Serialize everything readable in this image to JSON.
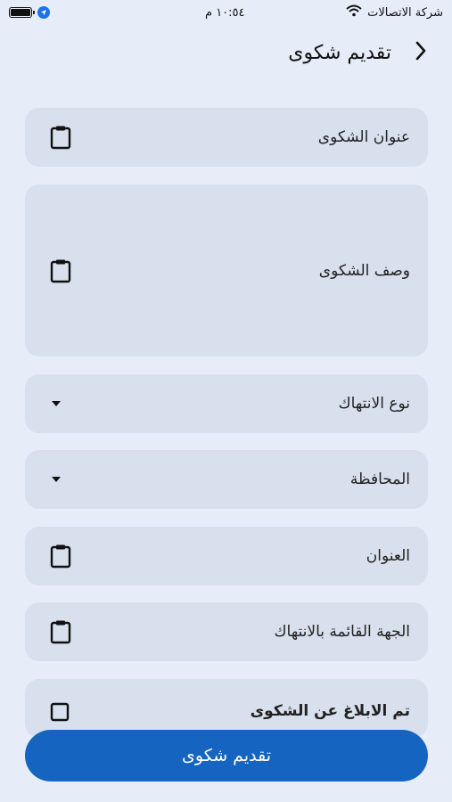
{
  "status_bar": {
    "time": "١٠:٥٤ م",
    "carrier": "شركة الاتصالات",
    "icons": [
      "battery-icon",
      "location-icon",
      "wifi-icon"
    ]
  },
  "header": {
    "title": "تقديم شكوى",
    "back_icon": "chevron-right-icon"
  },
  "form": {
    "complaint_title": "عنوان الشكوى",
    "complaint_description": "وصف الشكوى",
    "violation_type": "نوع الانتهاك",
    "governorate": "المحافظة",
    "address": "العنوان",
    "violating_party": "الجهة القائمة بالانتهاك",
    "reported_label": "تم الابلاغ عن الشكوى"
  },
  "submit": {
    "label": "تقديم شكوى"
  },
  "colors": {
    "background": "#e6edf8",
    "field": "#d7e0ec",
    "primary": "#1565c0"
  }
}
